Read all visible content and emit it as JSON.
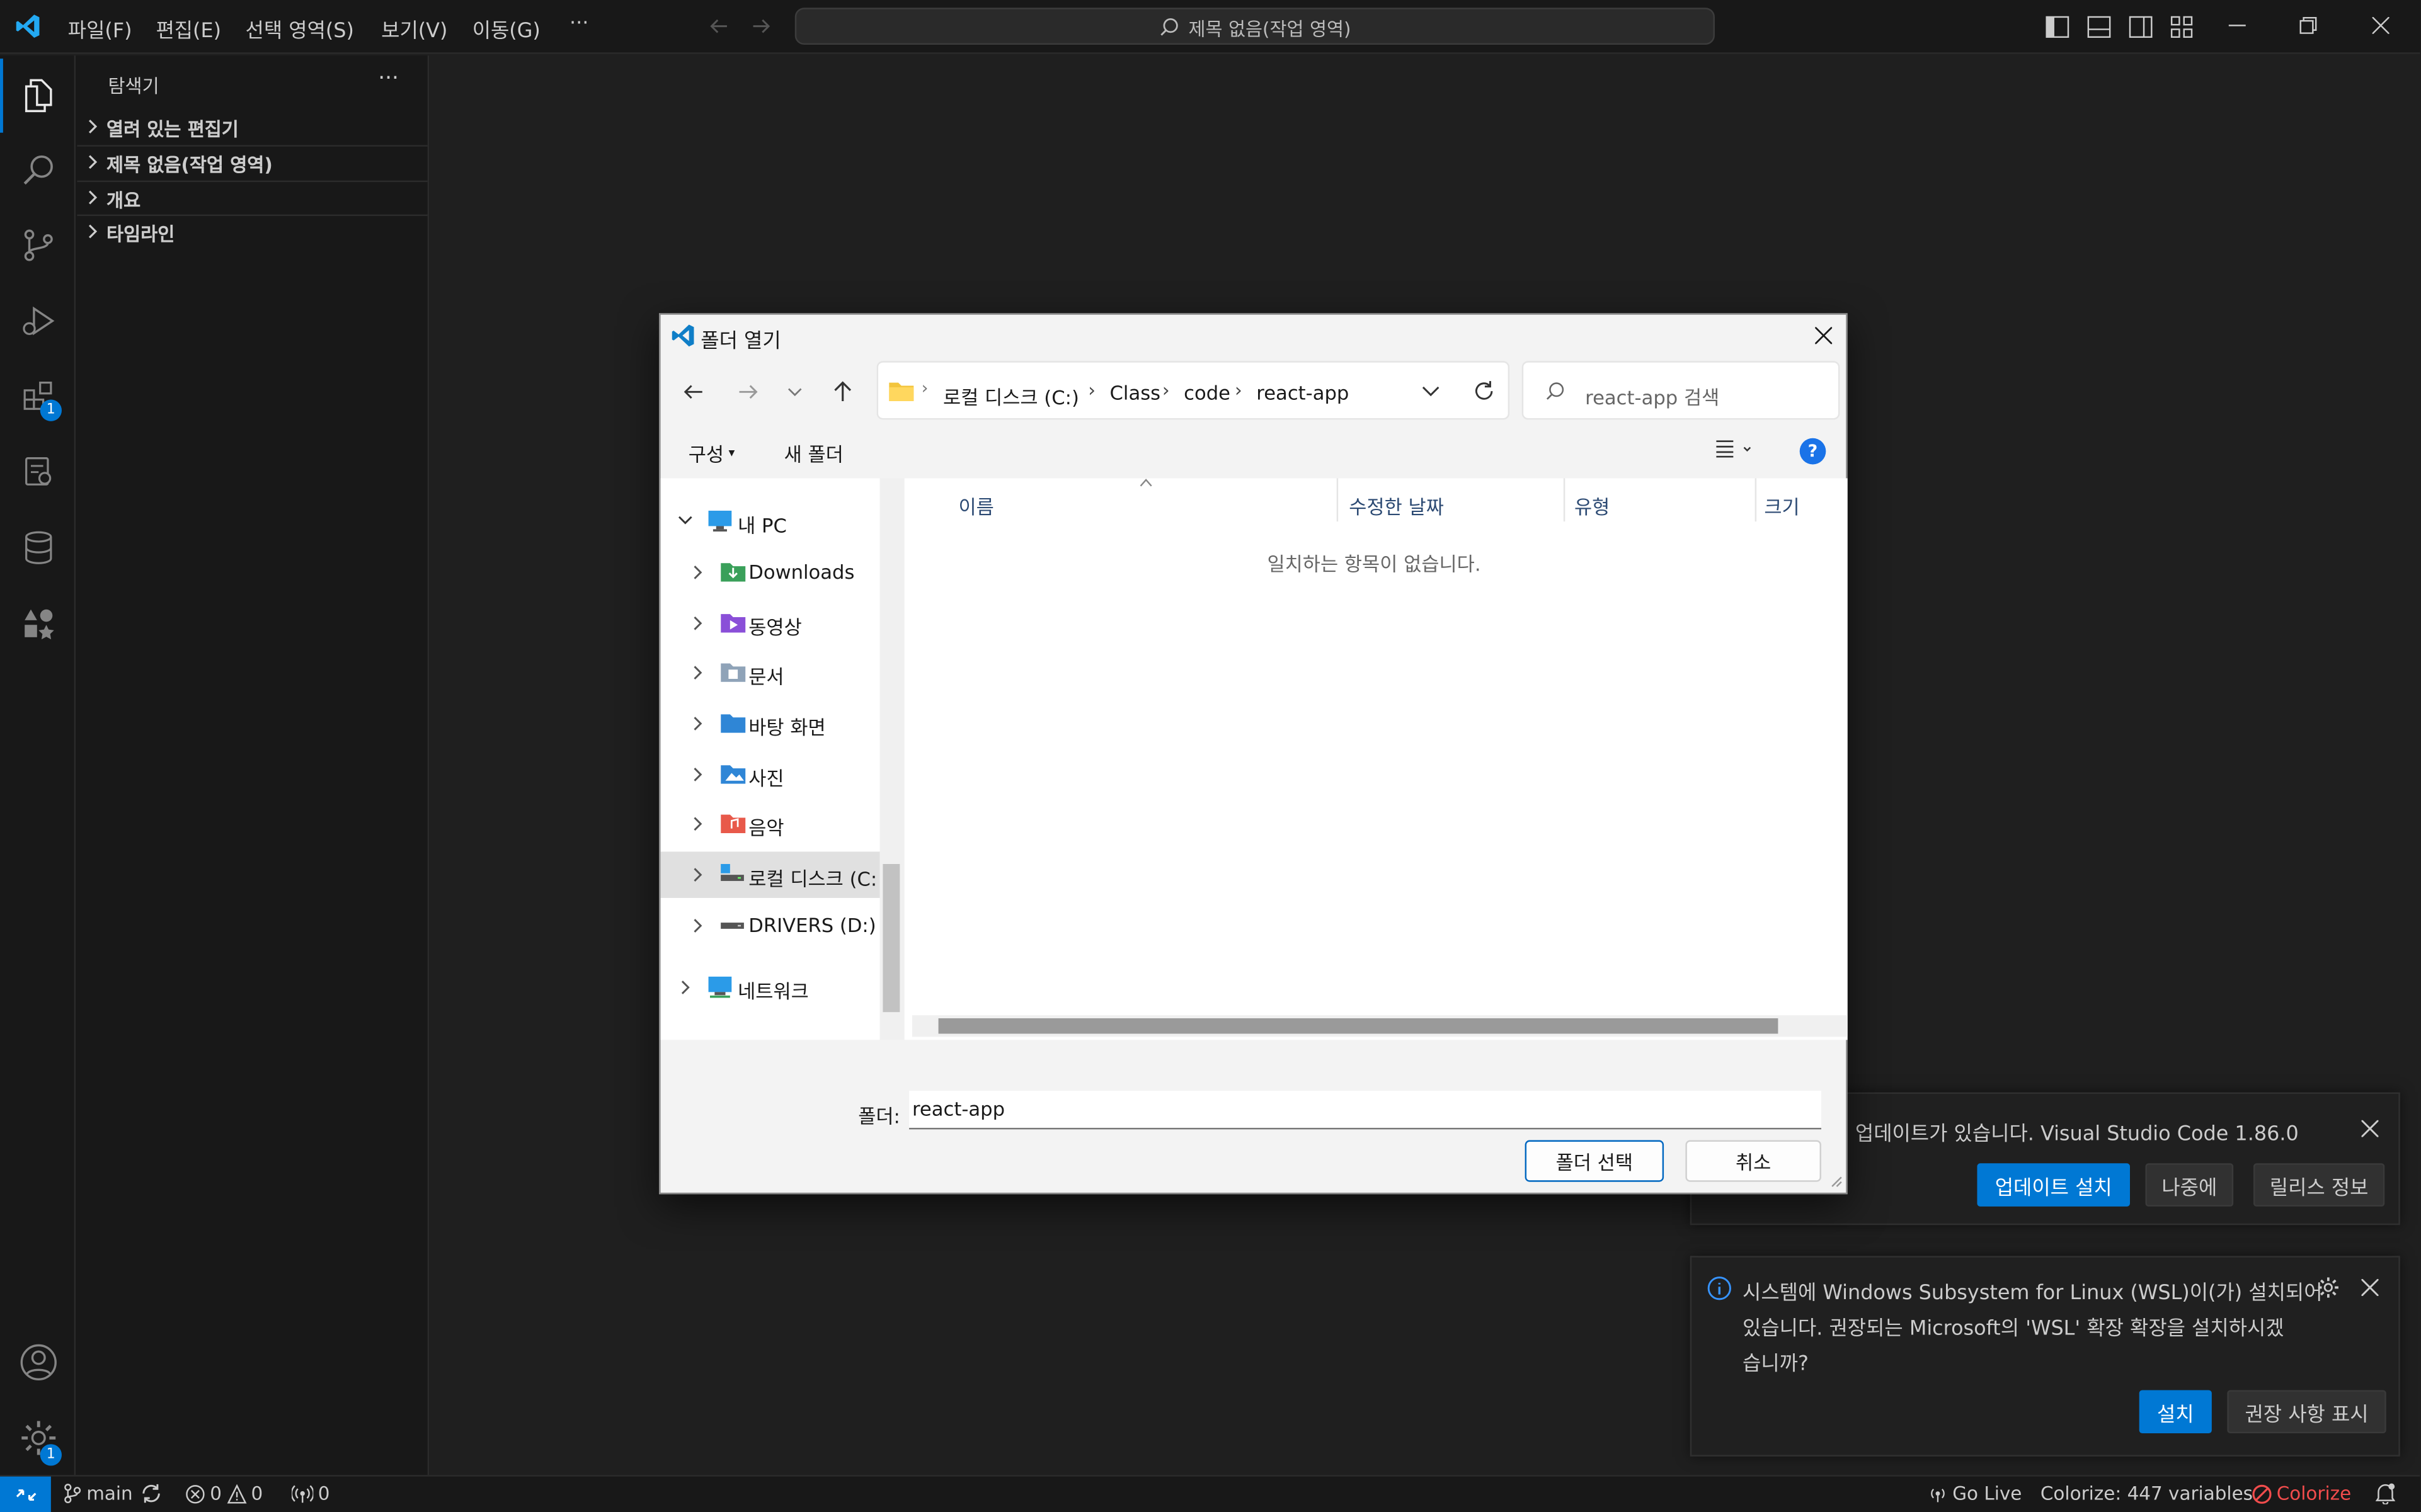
{
  "titlebar": {
    "menus": [
      "파일(F)",
      "편집(E)",
      "선택 영역(S)",
      "보기(V)",
      "이동(G)",
      "···"
    ],
    "command_center": "제목 없음(작업 영역)"
  },
  "activity": {
    "extensions_badge": "1",
    "settings_badge": "1"
  },
  "sidebar": {
    "title": "탐색기",
    "more": "···",
    "sections": [
      "열려 있는 편집기",
      "제목 없음(작업 영역)",
      "개요",
      "타임라인"
    ]
  },
  "dialog": {
    "title": "폴더 열기",
    "breadcrumb": [
      "로컬 디스크 (C:)",
      "Class",
      "code",
      "react-app"
    ],
    "search_placeholder": "react-app 검색",
    "organize": "구성",
    "new_folder": "새 폴더",
    "help": "?",
    "nav": [
      {
        "label": "내 PC",
        "icon": "pc-icon"
      },
      {
        "label": "Downloads",
        "icon": "downloads-folder-icon"
      },
      {
        "label": "동영상",
        "icon": "videos-folder-icon"
      },
      {
        "label": "문서",
        "icon": "documents-folder-icon"
      },
      {
        "label": "바탕 화면",
        "icon": "desktop-folder-icon"
      },
      {
        "label": "사진",
        "icon": "pictures-folder-icon"
      },
      {
        "label": "음악",
        "icon": "music-folder-icon"
      },
      {
        "label": "로컬 디스크 (C:",
        "icon": "drive-c-icon"
      },
      {
        "label": "DRIVERS (D:)",
        "icon": "drive-d-icon"
      },
      {
        "label": "네트워크",
        "icon": "network-icon"
      }
    ],
    "columns": [
      "이름",
      "수정한 날짜",
      "유형",
      "크기"
    ],
    "empty_message": "일치하는 항목이 없습니다.",
    "folder_label": "폴더:",
    "folder_value": "react-app",
    "select_button": "폴더 선택",
    "cancel_button": "취소"
  },
  "notifications": {
    "update": {
      "message": "업데이트가 있습니다. Visual Studio Code 1.86.0",
      "install": "업데이트 설치",
      "later": "나중에",
      "release_notes": "릴리스 정보"
    },
    "wsl": {
      "line1": "시스템에 Windows Subsystem for Linux (WSL)이(가) 설치되어",
      "line2": "있습니다. 권장되는 Microsoft의 'WSL' 확장 확장을 설치하시겠",
      "line3": "습니까?",
      "install": "설치",
      "show_recommendations": "권장 사항 표시"
    }
  },
  "statusbar": {
    "branch": "main",
    "errors": "0",
    "warnings": "0",
    "ports": "0",
    "go_live": "Go Live",
    "colorize_vars": "Colorize: 447 variables",
    "colorize": "Colorize"
  },
  "colors": {
    "accent": "#0078d4",
    "vscode_bg": "#1f1f1f",
    "dialog_bg": "#f3f3f3"
  }
}
